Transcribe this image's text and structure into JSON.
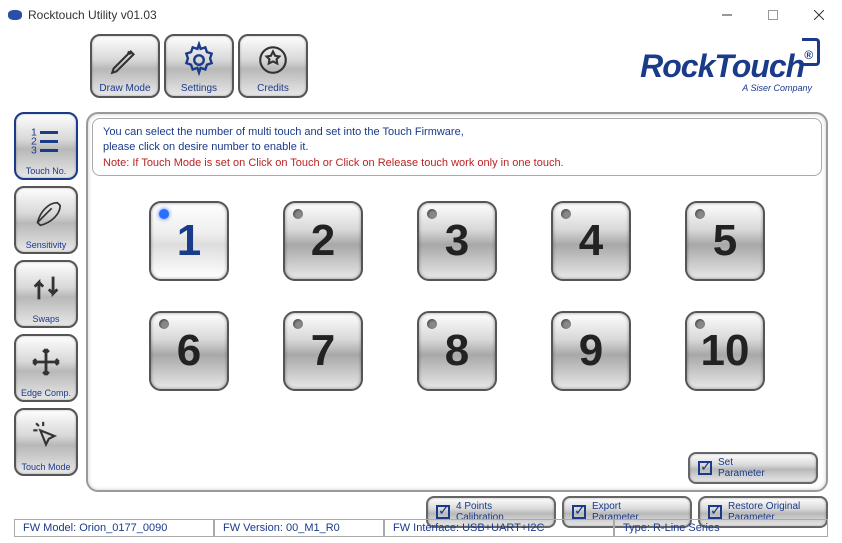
{
  "window": {
    "title": "Rocktouch Utility v01.03"
  },
  "logo": {
    "brand": "RockTouch",
    "sub": "A Siser Company",
    "reg": "®"
  },
  "toolbar": {
    "draw_mode": "Draw Mode",
    "settings": "Settings",
    "credits": "Credits"
  },
  "sidebar": {
    "touch_no": "Touch No.",
    "sensitivity": "Sensitivity",
    "swaps": "Swaps",
    "edge_comp": "Edge Comp.",
    "touch_mode": "Touch Mode"
  },
  "info": {
    "line1": "You can select the number of multi touch and set into the Touch Firmware,",
    "line2": "please click on desire number to enable it.",
    "note": "Note: If Touch Mode is set on Click on Touch or Click on Release touch work only in one touch."
  },
  "numbers": [
    "1",
    "2",
    "3",
    "4",
    "5",
    "6",
    "7",
    "8",
    "9",
    "10"
  ],
  "selected_number": 1,
  "actions": {
    "set_parameter": "Set\nParameter",
    "calibration": "4 Points\nCalibration",
    "export": "Export\nParameter",
    "restore": "Restore Original\nParameter"
  },
  "status": {
    "fw_model_label": "FW Model:",
    "fw_model": "Orion_0177_0090",
    "fw_version_label": "FW Version:",
    "fw_version": "00_M1_R0",
    "fw_interface_label": "FW Interface:",
    "fw_interface": "USB+UART+I2C",
    "type_label": "Type:",
    "type": "R-Line Series"
  }
}
